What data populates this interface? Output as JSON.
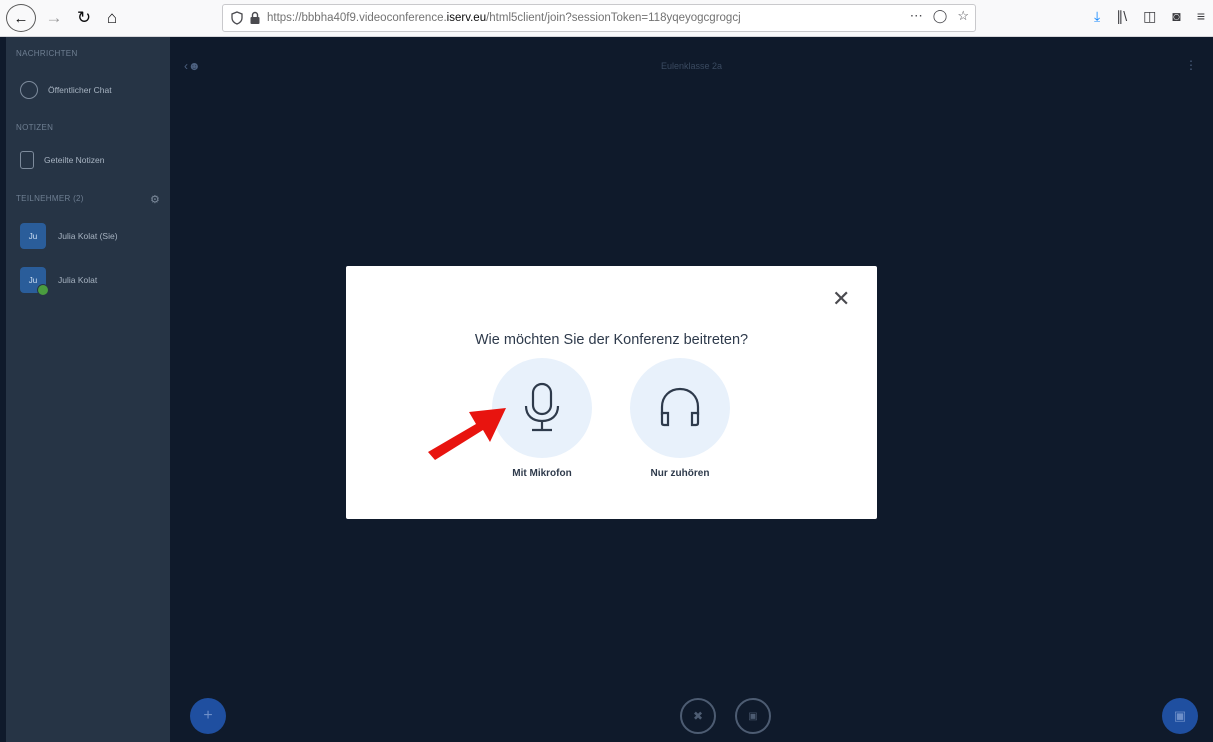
{
  "browser": {
    "back_icon": "arrow-left",
    "url_display": "https://bbbha40f9.videoconference.",
    "url_domain": "iserv.eu",
    "url_path": "/html5client/join?sessionToken=118yqeyogcgrogcj",
    "colors": {
      "download_icon": "#0a84ff"
    }
  },
  "sidebar": {
    "messages_title": "NACHRICHTEN",
    "public_chat": "Öffentlicher Chat",
    "notes_title": "NOTIZEN",
    "shared_notes": "Geteilte Notizen",
    "participants_title": "TEILNEHMER (2)",
    "users": [
      {
        "initials": "Ju",
        "name": "Julia Kolat (Sie)"
      },
      {
        "initials": "Ju",
        "name": "Julia Kolat"
      }
    ]
  },
  "main": {
    "meeting_title": "Eulenklasse 2a"
  },
  "modal": {
    "title": "Wie möchten Sie der Konferenz beitreten?",
    "option_microphone": "Mit Mikrofon",
    "option_listen": "Nur zuhören"
  },
  "theme": {
    "app_background": "#0f1a2b",
    "sidebar_background": "#263445",
    "accent_blue": "#1f4fa0",
    "annotation_arrow": "#e8140f"
  }
}
